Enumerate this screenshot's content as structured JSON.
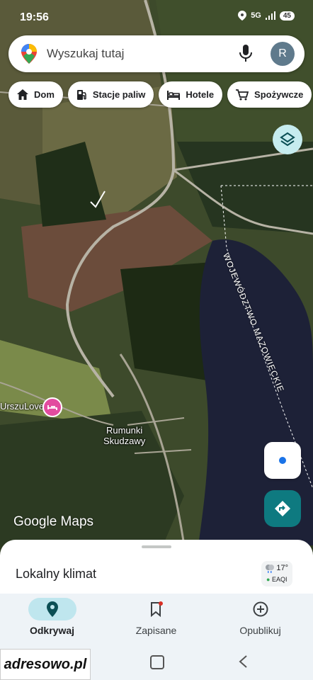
{
  "status": {
    "time": "19:56",
    "network": "5G",
    "battery": "45"
  },
  "search": {
    "placeholder": "Wyszukaj tutaj",
    "avatar_letter": "R"
  },
  "chips": [
    {
      "label": "Dom",
      "icon": "home-icon"
    },
    {
      "label": "Stacje paliw",
      "icon": "gas-station-icon"
    },
    {
      "label": "Hotele",
      "icon": "bed-icon"
    },
    {
      "label": "Spożywcze",
      "icon": "cart-icon"
    }
  ],
  "map": {
    "labels": {
      "place1": "Rumunki\nSkudzawy",
      "poi": "UrszuLove",
      "region": "WOJEWÓDZTWO MAZOWIECKIE"
    },
    "branding": "Google Maps"
  },
  "sheet": {
    "title": "Lokalny klimat",
    "weather": {
      "temp": "17°",
      "aqi_label": "EAQI"
    }
  },
  "nav": [
    {
      "label": "Odkrywaj",
      "icon": "location-pin-icon",
      "active": true
    },
    {
      "label": "Zapisane",
      "icon": "bookmark-icon",
      "active": false
    },
    {
      "label": "Opublikuj",
      "icon": "add-circle-icon",
      "active": false
    }
  ],
  "watermark": "adresowo.pl",
  "colors": {
    "accent": "#0e7a80",
    "active_nav_bg": "#bfe6ee",
    "layers_bg": "#c6ecef"
  }
}
